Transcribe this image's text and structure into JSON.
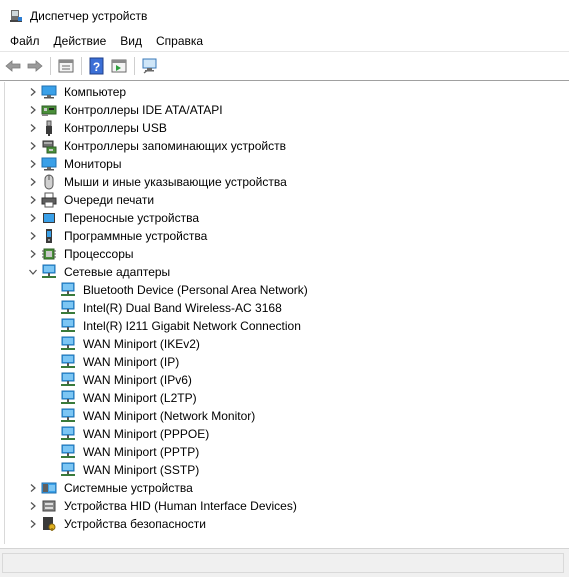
{
  "window": {
    "title": "Диспетчер устройств"
  },
  "menu": {
    "items": [
      {
        "label": "Файл"
      },
      {
        "label": "Действие"
      },
      {
        "label": "Вид"
      },
      {
        "label": "Справка"
      }
    ]
  },
  "toolbar": {
    "buttons": [
      {
        "icon": "back-arrow-icon"
      },
      {
        "icon": "forward-arrow-icon"
      },
      {
        "icon": "properties-icon"
      },
      {
        "icon": "help-icon"
      },
      {
        "icon": "view-icon"
      },
      {
        "icon": "scan-hardware-icon"
      }
    ]
  },
  "tree": {
    "items": [
      {
        "label": "Компьютер",
        "icon": "computer-icon",
        "expanded": false,
        "level": 0
      },
      {
        "label": "Контроллеры IDE ATA/ATAPI",
        "icon": "ide-controller-icon",
        "expanded": false,
        "level": 0
      },
      {
        "label": "Контроллеры USB",
        "icon": "usb-icon",
        "expanded": false,
        "level": 0
      },
      {
        "label": "Контроллеры запоминающих устройств",
        "icon": "storage-controller-icon",
        "expanded": false,
        "level": 0
      },
      {
        "label": "Мониторы",
        "icon": "monitor-icon",
        "expanded": false,
        "level": 0
      },
      {
        "label": "Мыши и иные указывающие устройства",
        "icon": "mouse-icon",
        "expanded": false,
        "level": 0
      },
      {
        "label": "Очереди печати",
        "icon": "printer-icon",
        "expanded": false,
        "level": 0
      },
      {
        "label": "Переносные устройства",
        "icon": "portable-device-icon",
        "expanded": false,
        "level": 0
      },
      {
        "label": "Программные устройства",
        "icon": "software-device-icon",
        "expanded": false,
        "level": 0
      },
      {
        "label": "Процессоры",
        "icon": "processor-icon",
        "expanded": false,
        "level": 0
      },
      {
        "label": "Сетевые адаптеры",
        "icon": "network-adapter-icon",
        "expanded": true,
        "level": 0
      },
      {
        "label": "Bluetooth Device (Personal Area Network)",
        "icon": "network-adapter-icon",
        "level": 1
      },
      {
        "label": "Intel(R) Dual Band Wireless-AC 3168",
        "icon": "network-adapter-icon",
        "level": 1
      },
      {
        "label": "Intel(R) I211 Gigabit Network Connection",
        "icon": "network-adapter-icon",
        "level": 1
      },
      {
        "label": "WAN Miniport (IKEv2)",
        "icon": "network-adapter-icon",
        "level": 1
      },
      {
        "label": "WAN Miniport (IP)",
        "icon": "network-adapter-icon",
        "level": 1
      },
      {
        "label": "WAN Miniport (IPv6)",
        "icon": "network-adapter-icon",
        "level": 1
      },
      {
        "label": "WAN Miniport (L2TP)",
        "icon": "network-adapter-icon",
        "level": 1
      },
      {
        "label": "WAN Miniport (Network Monitor)",
        "icon": "network-adapter-icon",
        "level": 1
      },
      {
        "label": "WAN Miniport (PPPOE)",
        "icon": "network-adapter-icon",
        "level": 1
      },
      {
        "label": "WAN Miniport (PPTP)",
        "icon": "network-adapter-icon",
        "level": 1
      },
      {
        "label": "WAN Miniport (SSTP)",
        "icon": "network-adapter-icon",
        "level": 1
      },
      {
        "label": "Системные устройства",
        "icon": "system-device-icon",
        "expanded": false,
        "level": 0
      },
      {
        "label": "Устройства HID (Human Interface Devices)",
        "icon": "hid-icon",
        "expanded": false,
        "level": 0
      },
      {
        "label": "Устройства безопасности",
        "icon": "security-device-icon",
        "expanded": false,
        "level": 0
      }
    ]
  },
  "colors": {
    "accent": "#1e90e0",
    "monitor_blue": "#3aa0e8",
    "chevron": "#505050"
  }
}
